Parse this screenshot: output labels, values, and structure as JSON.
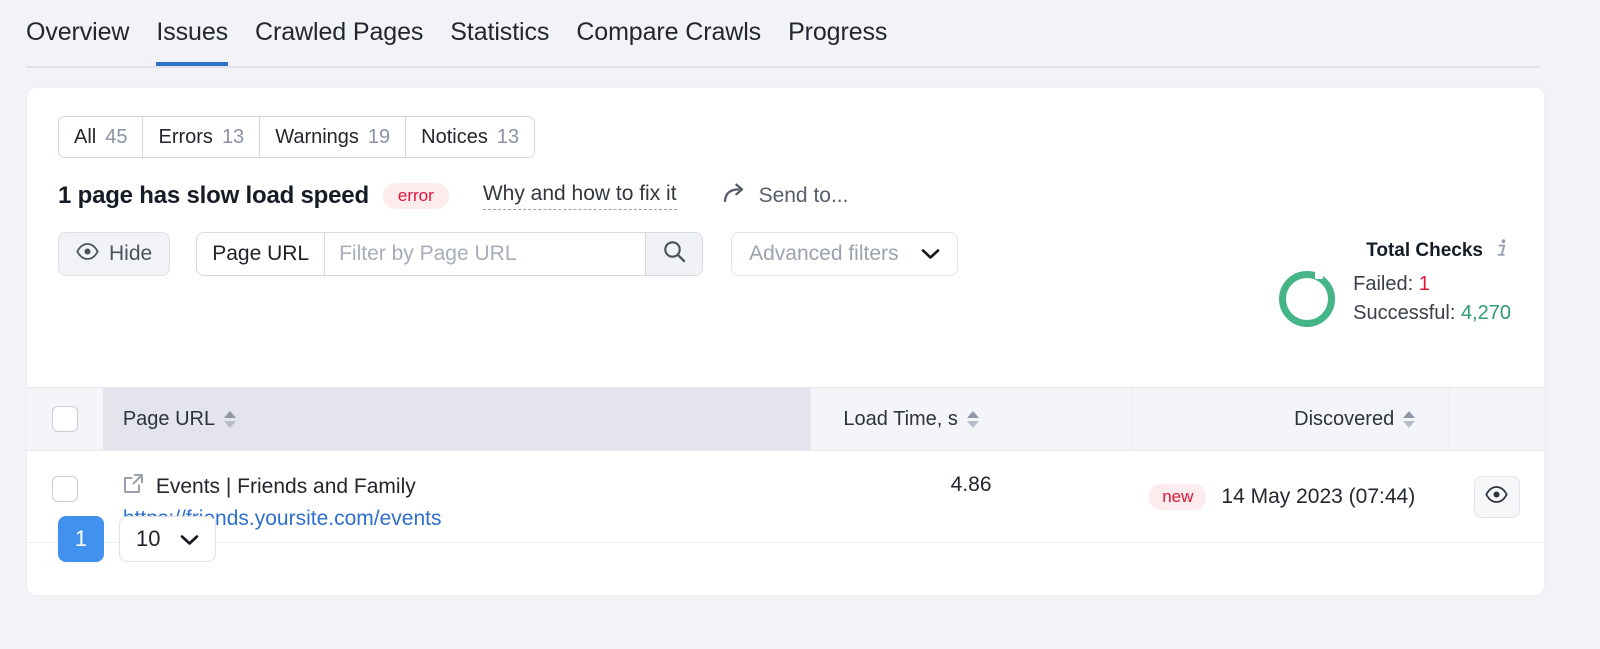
{
  "tabs": [
    {
      "label": "Overview",
      "active": false
    },
    {
      "label": "Issues",
      "active": true
    },
    {
      "label": "Crawled Pages",
      "active": false
    },
    {
      "label": "Statistics",
      "active": false
    },
    {
      "label": "Compare Crawls",
      "active": false
    },
    {
      "label": "Progress",
      "active": false
    }
  ],
  "segmented": [
    {
      "label": "All",
      "count": "45"
    },
    {
      "label": "Errors",
      "count": "13"
    },
    {
      "label": "Warnings",
      "count": "19"
    },
    {
      "label": "Notices",
      "count": "13"
    }
  ],
  "issue": {
    "title": "1 page has slow load speed",
    "severity": "error",
    "fix_link": "Why and how to fix it",
    "send_to": "Send to..."
  },
  "toolbar": {
    "hide_label": "Hide",
    "filter_field_label": "Page URL",
    "filter_placeholder": "Filter by Page URL",
    "filter_value": "",
    "advanced_filters": "Advanced filters"
  },
  "total_checks": {
    "title": "Total Checks",
    "failed_label": "Failed:",
    "failed_value": "1",
    "successful_label": "Successful:",
    "successful_value": "4,270",
    "donut_color": "#45b587",
    "failed_color": "#e0153a",
    "successful_color": "#2c9c6f"
  },
  "table": {
    "columns": [
      {
        "label": "Page URL",
        "sortable": true
      },
      {
        "label": "Load Time, s",
        "sortable": true
      },
      {
        "label": "Discovered",
        "sortable": true
      }
    ],
    "rows": [
      {
        "title": "Events | Friends and Family",
        "url": "https://friends.yoursite.com/events",
        "load_time": "4.86",
        "discovered_badge": "new",
        "discovered": "14 May 2023 (07:44)"
      }
    ]
  },
  "pagination": {
    "current_page": "1",
    "page_size": "10"
  },
  "colors": {
    "accent": "#2f70c8",
    "page_bg": "#f2f3f7",
    "link": "#2f6fd0",
    "pager_active": "#4191ef"
  }
}
